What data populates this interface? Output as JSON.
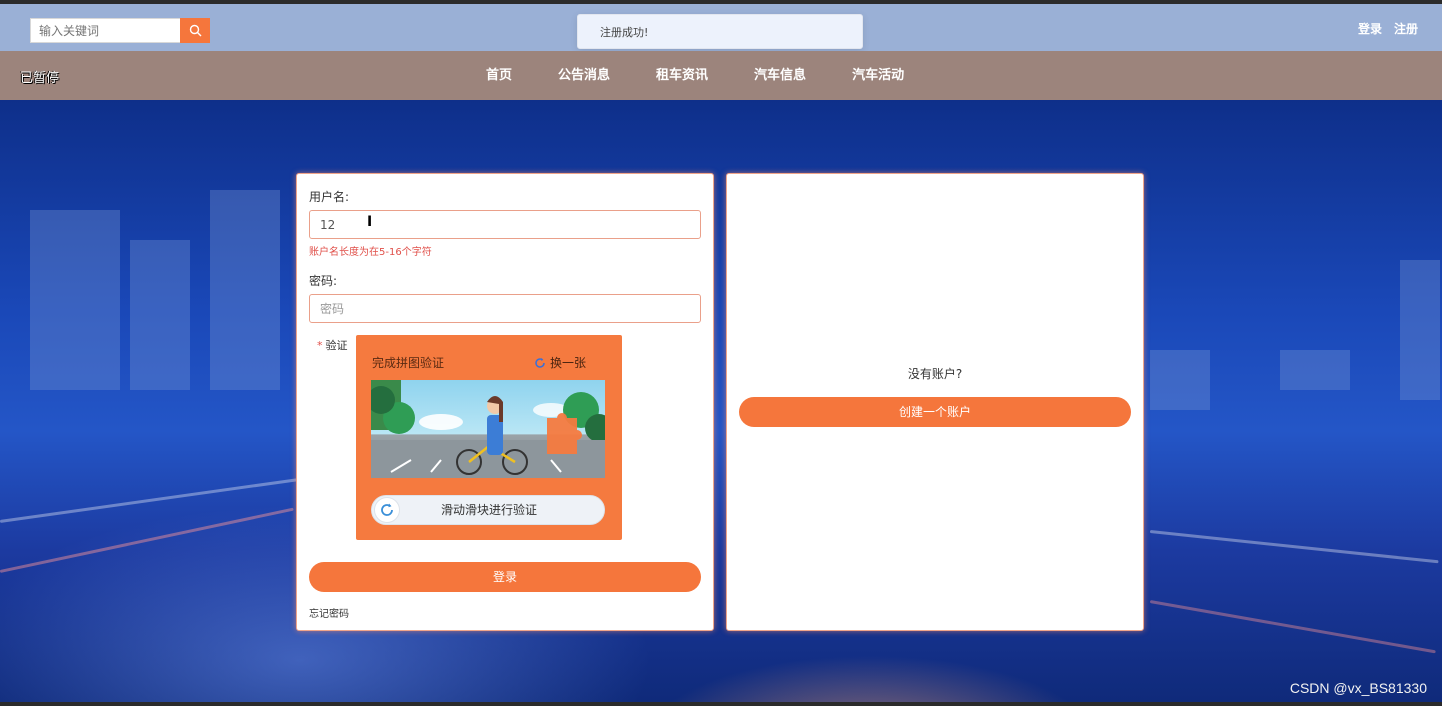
{
  "header": {
    "search_placeholder": "输入关键词",
    "login_link": "登录",
    "register_link": "注册"
  },
  "toast": {
    "message": "注册成功!"
  },
  "nav": {
    "status_text": "已暂停",
    "items": [
      "首页",
      "公告消息",
      "租车资讯",
      "汽车信息",
      "汽车活动"
    ]
  },
  "login_form": {
    "username_label": "用户名:",
    "username_value": "12",
    "username_error": "账户名长度为在5-16个字符",
    "password_label": "密码:",
    "password_placeholder": "密码",
    "verify_required_mark": "*",
    "verify_label": "验证",
    "captcha": {
      "title": "完成拼图验证",
      "refresh_label": "换一张",
      "slider_text": "滑动滑块进行验证"
    },
    "submit_label": "登录",
    "forgot_password": "忘记密码"
  },
  "signup_panel": {
    "prompt": "没有账户?",
    "create_account_label": "创建一个账户"
  },
  "watermark": "CSDN @vx_BS81330",
  "colors": {
    "accent": "#f5763c",
    "topbar": "#9ab0d6",
    "navbar": "#9c847c",
    "error": "#e0504a"
  }
}
